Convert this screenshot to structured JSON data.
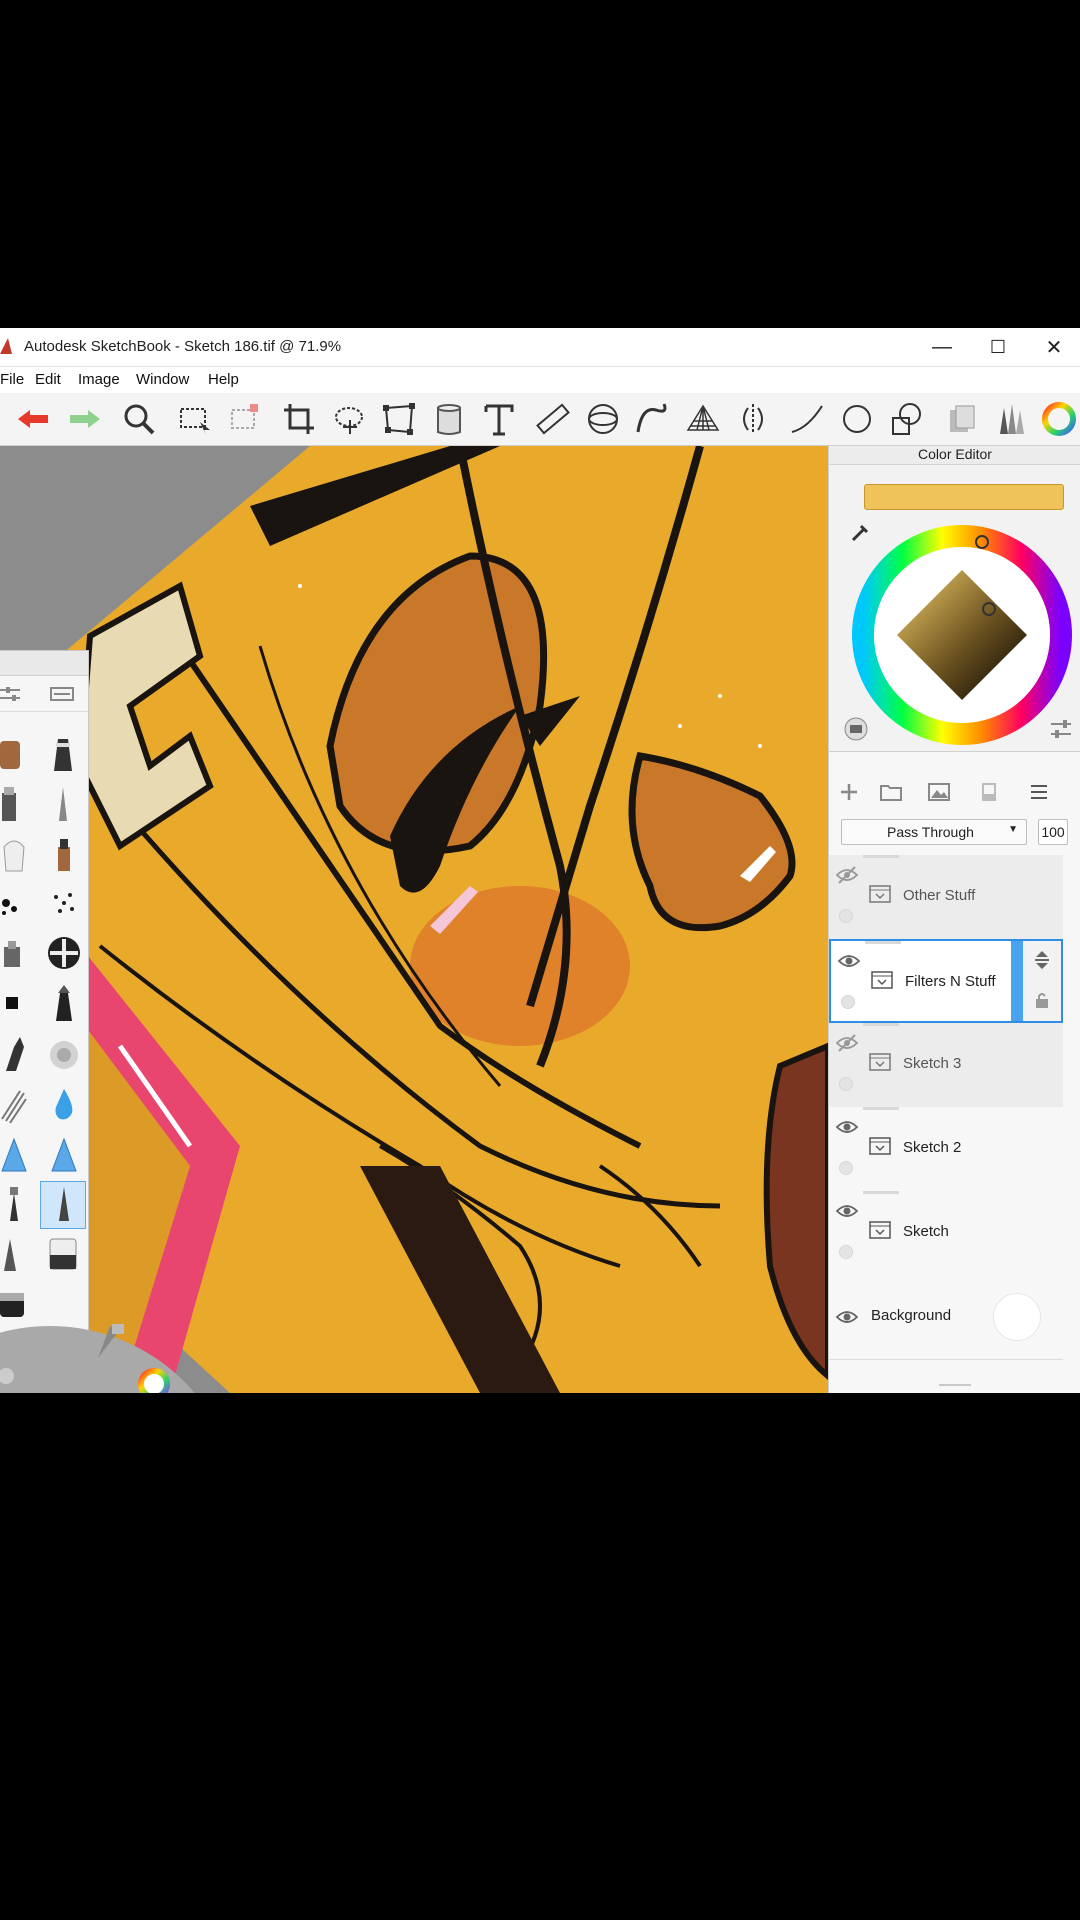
{
  "window": {
    "title": "Autodesk SketchBook - Sketch 186.tif @ 71.9%",
    "minimize": "—",
    "maximize": "☐",
    "close": "✕"
  },
  "menu": [
    "File",
    "Edit",
    "Image",
    "Window",
    "Help"
  ],
  "toolbar_icons": [
    "undo-icon",
    "redo-icon",
    "zoom-icon",
    "selection-icon",
    "transform-icon",
    "crop-icon",
    "lasso-icon",
    "distort-icon",
    "fill-icon",
    "text-icon",
    "ruler-icon",
    "ellipse-guide-icon",
    "french-curve-icon",
    "perspective-icon",
    "symmetry-icon",
    "stroke-icon",
    "circle-icon",
    "shapes-icon",
    "copic-icon",
    "brush-library-icon",
    "color-wheel-icon"
  ],
  "color_editor": {
    "title": "Color Editor",
    "current_color": "#f0c35a"
  },
  "layers": {
    "blend_mode": "Pass Through",
    "opacity": "100",
    "items": [
      {
        "name": "Other Stuff",
        "visible": false,
        "state": "hidden"
      },
      {
        "name": "Filters N Stuff",
        "visible": true,
        "state": "selected"
      },
      {
        "name": "Sketch 3",
        "visible": false,
        "state": "hidden"
      },
      {
        "name": "Sketch 2",
        "visible": true,
        "state": "normal"
      },
      {
        "name": "Sketch",
        "visible": true,
        "state": "normal"
      }
    ],
    "background_label": "Background"
  },
  "colors": {
    "accent": "#2f8de4",
    "hair": "#e9aa2c",
    "skin": "#c9782a",
    "pink": "#e8466e",
    "ink": "#1a1410"
  }
}
